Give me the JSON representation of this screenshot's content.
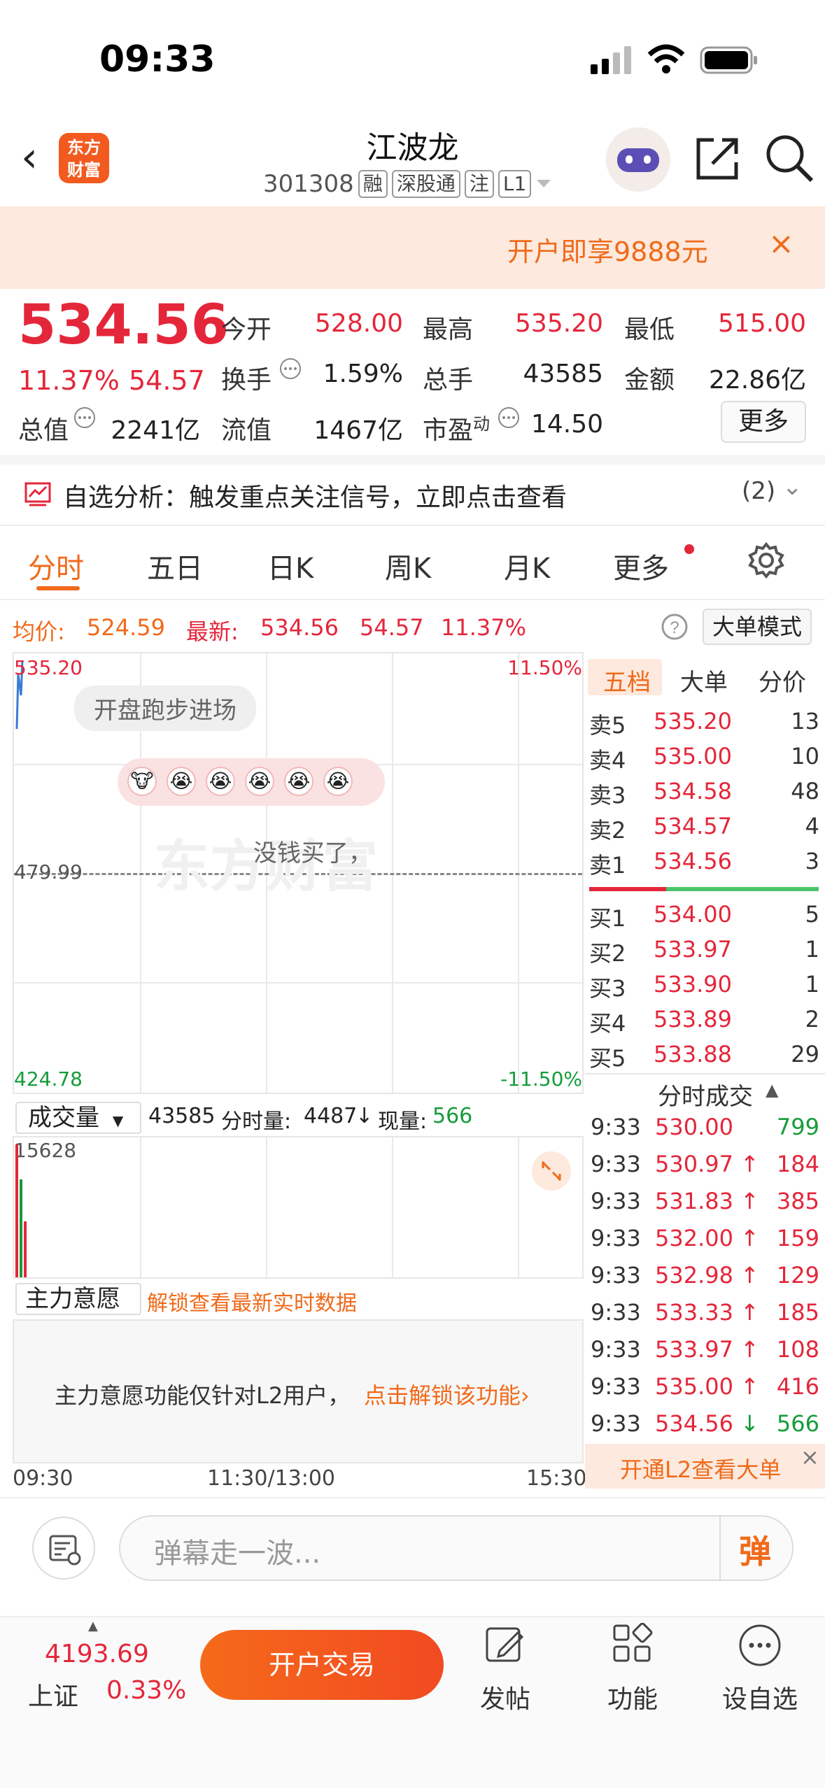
{
  "status": {
    "time": "09:33"
  },
  "header": {
    "back": "‹",
    "logo_line1": "东方",
    "logo_line2": "财富",
    "title": "江波龙",
    "code": "301308",
    "tags": [
      "融",
      "深股通",
      "注",
      "L1"
    ]
  },
  "banner": {
    "text": "开户即享9888元",
    "close": "×"
  },
  "quote": {
    "price": "534.56",
    "change_pct": "11.37%",
    "change": "54.57",
    "open_label": "今开",
    "open": "528.00",
    "high_label": "最高",
    "high": "535.20",
    "low_label": "最低",
    "low": "515.00",
    "turnover_label": "换手",
    "turnover": "1.59%",
    "volume_label": "总手",
    "volume": "43585",
    "amount_label": "金额",
    "amount": "22.86亿",
    "mktcap_label": "总值",
    "mktcap": "2241亿",
    "float_label": "流值",
    "float": "1467亿",
    "pe_label": "市盈",
    "pe_sup": "动",
    "pe": "14.50",
    "more": "更多"
  },
  "analysis": {
    "text": "自选分析：触发重点关注信号，立即点击查看",
    "count": "(2)"
  },
  "tabs": [
    "分时",
    "五日",
    "日K",
    "周K",
    "月K",
    "更多"
  ],
  "info": {
    "avg_label": "均价:",
    "avg": "524.59",
    "latest_label": "最新:",
    "latest": "534.56",
    "chg": "54.57",
    "pct": "11.37%",
    "mode": "大单模式"
  },
  "chart": {
    "ymax": "535.20",
    "ymid": "479.99",
    "ymin": "424.78",
    "pmax": "11.50%",
    "pmin": "-11.50%",
    "bubble1": "开盘跑步进场",
    "bubble2": "没钱买了，",
    "watermark": "东方财富",
    "x_start": "09:30",
    "x_mid": "11:30/13:00",
    "x_end": "15:30"
  },
  "volume": {
    "select": "成交量",
    "total": "43585",
    "minute_label": "分时量:",
    "minute": "4487",
    "arrow": "↓",
    "now_label": "现量:",
    "now": "566",
    "ymax": "15628"
  },
  "main_force": {
    "select": "主力意愿",
    "unlock": "解锁查看最新实时数据",
    "notice": "主力意愿功能仅针对L2用户，",
    "notice_link": "点击解锁该功能›"
  },
  "panel": {
    "tabs": [
      "五档",
      "大单",
      "分价"
    ],
    "sell": [
      [
        "卖5",
        "535.20",
        "13"
      ],
      [
        "卖4",
        "535.00",
        "10"
      ],
      [
        "卖3",
        "534.58",
        "48"
      ],
      [
        "卖2",
        "534.57",
        "4"
      ],
      [
        "卖1",
        "534.56",
        "3"
      ]
    ],
    "buy": [
      [
        "买1",
        "534.00",
        "5"
      ],
      [
        "买2",
        "533.97",
        "1"
      ],
      [
        "买3",
        "533.90",
        "1"
      ],
      [
        "买4",
        "533.89",
        "2"
      ],
      [
        "买5",
        "533.88",
        "29"
      ]
    ],
    "trades_title": "分时成交",
    "trades": [
      [
        "9:33",
        "530.00",
        "",
        "799"
      ],
      [
        "9:33",
        "530.97",
        "↑",
        "184"
      ],
      [
        "9:33",
        "531.83",
        "↑",
        "385"
      ],
      [
        "9:33",
        "532.00",
        "↑",
        "159"
      ],
      [
        "9:33",
        "532.98",
        "↑",
        "129"
      ],
      [
        "9:33",
        "533.33",
        "↑",
        "185"
      ],
      [
        "9:33",
        "533.97",
        "↑",
        "108"
      ],
      [
        "9:33",
        "535.00",
        "↑",
        "416"
      ],
      [
        "9:33",
        "534.56",
        "↓",
        "566"
      ]
    ],
    "l2": "开通L2查看大单"
  },
  "danmu": {
    "placeholder": "弹幕走一波...",
    "btn": "弹"
  },
  "bottom": {
    "index_value": "4193.69",
    "index_name": "上证",
    "index_pct": "0.33%",
    "trade": "开户交易",
    "post": "发帖",
    "func": "功能",
    "watch": "设自选"
  }
}
